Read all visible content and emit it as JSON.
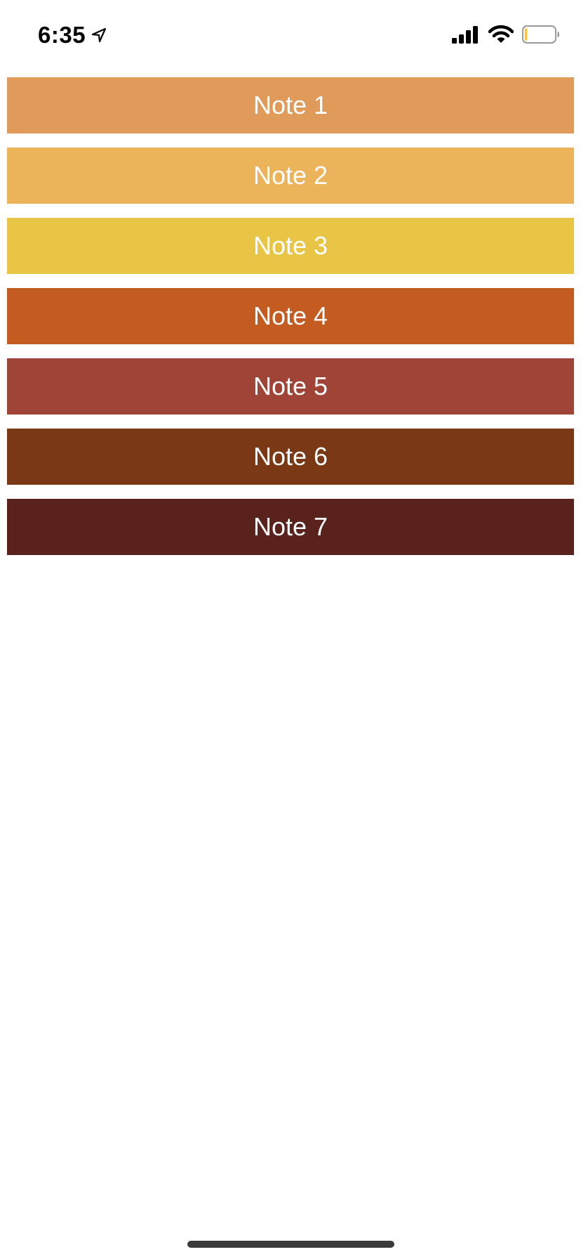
{
  "status_bar": {
    "time": "6:35",
    "location_icon": "location-arrow-icon",
    "signal_icon": "cellular-signal-icon",
    "wifi_icon": "wifi-icon",
    "battery_icon": "battery-low-icon",
    "battery_level_fraction": 0.08,
    "battery_color": "#f5c542"
  },
  "notes": [
    {
      "label": "Note 1",
      "color": "#e09b5b"
    },
    {
      "label": "Note 2",
      "color": "#ebb35a"
    },
    {
      "label": "Note 3",
      "color": "#e8c544"
    },
    {
      "label": "Note 4",
      "color": "#c45c22"
    },
    {
      "label": "Note 5",
      "color": "#a04438"
    },
    {
      "label": "Note 6",
      "color": "#7a3814"
    },
    {
      "label": "Note 7",
      "color": "#5a221d"
    }
  ],
  "home_indicator_color": "#3a3a3a"
}
